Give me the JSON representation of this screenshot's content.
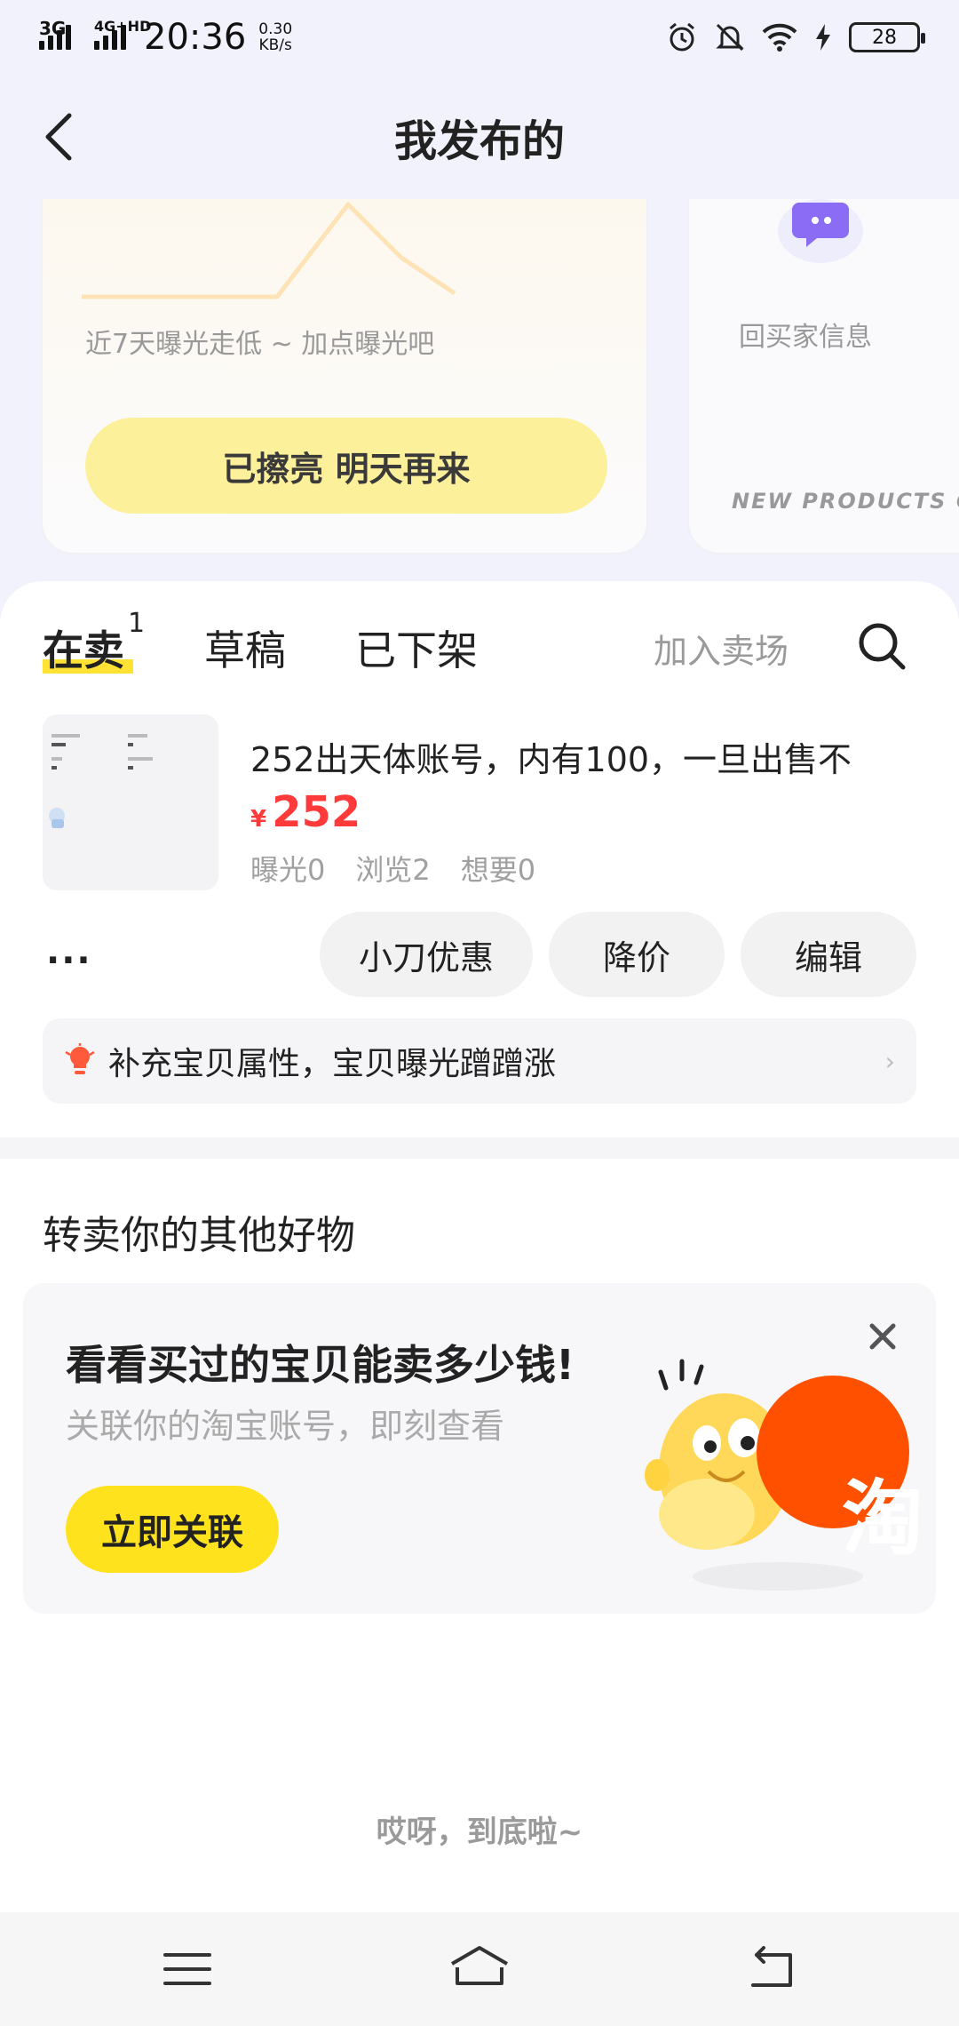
{
  "status_bar": {
    "net1": "3G",
    "net2": "4G+HD",
    "time": "20:36",
    "speed_value": "0.30",
    "speed_unit": "KB/s",
    "battery": "28"
  },
  "header": {
    "title": "我发布的"
  },
  "exposure_card": {
    "hint": "近7天曝光走低 ~ 加点曝光吧",
    "button": "已擦亮 明天再来"
  },
  "buyer_card": {
    "label": "回买家信息",
    "promo": "NEW PRODUCTS CO"
  },
  "tabs": {
    "selling": "在卖",
    "selling_count": "1",
    "drafts": "草稿",
    "off_shelf": "已下架",
    "join_market": "加入卖场"
  },
  "item": {
    "title": "252出天体账号，内有100，一旦出售不",
    "currency": "¥",
    "price": "252",
    "exposure": "曝光0",
    "views": "浏览2",
    "wants": "想要0",
    "more": "···",
    "actions": [
      "小刀优惠",
      "降价",
      "编辑"
    ]
  },
  "tip": {
    "text": "补充宝贝属性，宝贝曝光蹭蹭涨",
    "chevron": "›"
  },
  "resell": {
    "title": "转卖你的其他好物",
    "card_heading": "看看买过的宝贝能卖多少钱!",
    "card_sub": "关联你的淘宝账号，即刻查看",
    "link_button": "立即关联",
    "badge": "淘"
  },
  "footer": {
    "end_text": "哎呀，到底啦~"
  },
  "colors": {
    "accent_yellow": "#ffe21e",
    "price_red": "#ff3a3a",
    "taobao_orange": "#ff5000"
  }
}
